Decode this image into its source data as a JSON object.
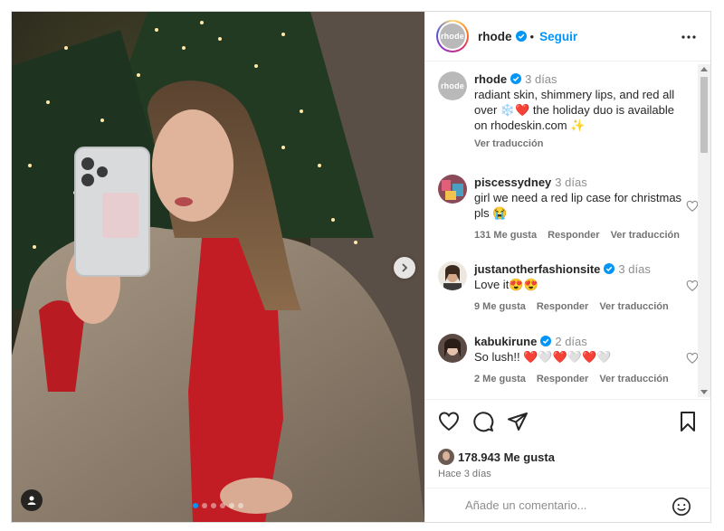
{
  "post": {
    "image_alt": "photo",
    "carousel": {
      "count": 6,
      "active": 0
    }
  },
  "header": {
    "avatar_text": "rhode",
    "username": "rhode",
    "separator": "•",
    "follow_label": "Seguir"
  },
  "caption": {
    "username": "rhode",
    "time": "3 días",
    "text": "radiant skin, shimmery lips, and red all over ❄️❤️ the holiday duo is available on rhodeskin.com ✨",
    "translate": "Ver traducción"
  },
  "comments": [
    {
      "username": "piscessydney",
      "verified": false,
      "time": "3 días",
      "text": "girl we need a red lip case for christmas pls 😭",
      "likes": "131 Me gusta",
      "reply": "Responder",
      "translate": "Ver traducción"
    },
    {
      "username": "justanotherfashionsite",
      "verified": true,
      "time": "3 días",
      "text": "Love it😍😍",
      "likes": "9 Me gusta",
      "reply": "Responder",
      "translate": "Ver traducción"
    },
    {
      "username": "kabukirune",
      "verified": true,
      "time": "2 días",
      "text": "So lush!! ❤️🤍❤️🤍❤️🤍",
      "likes": "2 Me gusta",
      "reply": "Responder",
      "translate": "Ver traducción"
    }
  ],
  "footer": {
    "likes_count": "178.943 Me gusta",
    "posted": "Hace 3 días",
    "add_comment_placeholder": "Añade un comentario..."
  },
  "colors": {
    "accent": "#0095f6",
    "verified": "#0095f6",
    "text": "#262626",
    "muted": "#737373"
  },
  "icons": [
    "more-icon",
    "heart-icon",
    "comment-icon",
    "share-icon",
    "bookmark-icon",
    "emoji-icon",
    "chevron-right-icon",
    "user-tag-icon",
    "verified-badge-icon"
  ]
}
